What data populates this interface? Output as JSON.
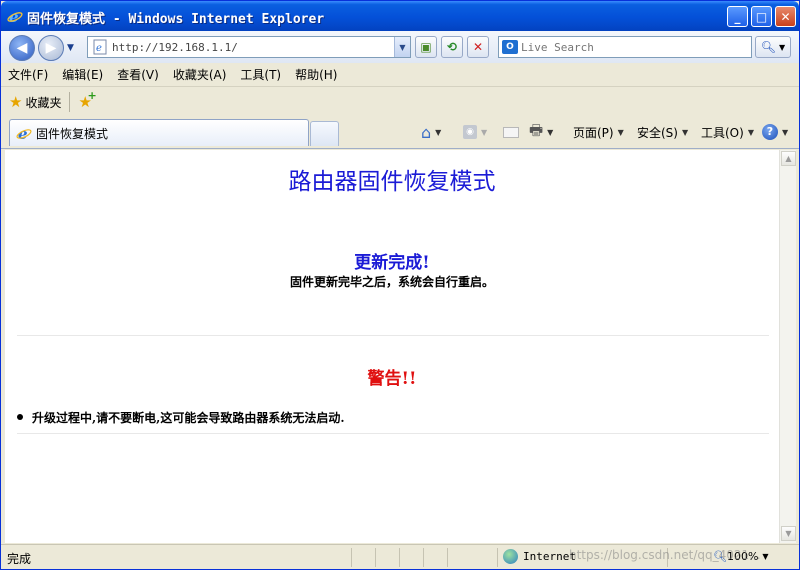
{
  "window": {
    "title": "固件恢复模式 - Windows Internet Explorer",
    "buttons": {
      "minimize": "_",
      "maximize": "□",
      "close": "✕"
    }
  },
  "address": {
    "url": "http://192.168.1.1/"
  },
  "search": {
    "placeholder": "Live Search"
  },
  "menu": {
    "items": [
      "文件(F)",
      "编辑(E)",
      "查看(V)",
      "收藏夹(A)",
      "工具(T)",
      "帮助(H)"
    ]
  },
  "favorites": {
    "label": "收藏夹"
  },
  "tab": {
    "title": "固件恢复模式"
  },
  "commands": {
    "page": "页面(P)",
    "safety": "安全(S)",
    "tools": "工具(O)"
  },
  "page": {
    "heading": "路由器固件恢复模式",
    "status_heading": "更新完成!",
    "status_text": "固件更新完毕之后，系统会自行重启。",
    "warning_heading": "警告!!",
    "warning_item": "升级过程中,请不要断电,这可能会导致路由器系统无法启动."
  },
  "statusbar": {
    "status": "完成",
    "zone": "Internet",
    "zoom": "100%",
    "watermark": "https://blog.csdn.net/qq_4021..."
  },
  "colors": {
    "heading_blue": "#1b1bd6",
    "warning_red": "#e01010",
    "titlebar_blue": "#0450d8"
  },
  "icons": {
    "back": "back-arrow-icon",
    "forward": "forward-arrow-icon",
    "refresh": "refresh-icon",
    "stop": "stop-icon",
    "search": "magnifier-icon",
    "home": "home-icon",
    "feeds": "feeds-icon",
    "mail": "mail-icon",
    "print": "printer-icon",
    "help": "help-icon"
  }
}
